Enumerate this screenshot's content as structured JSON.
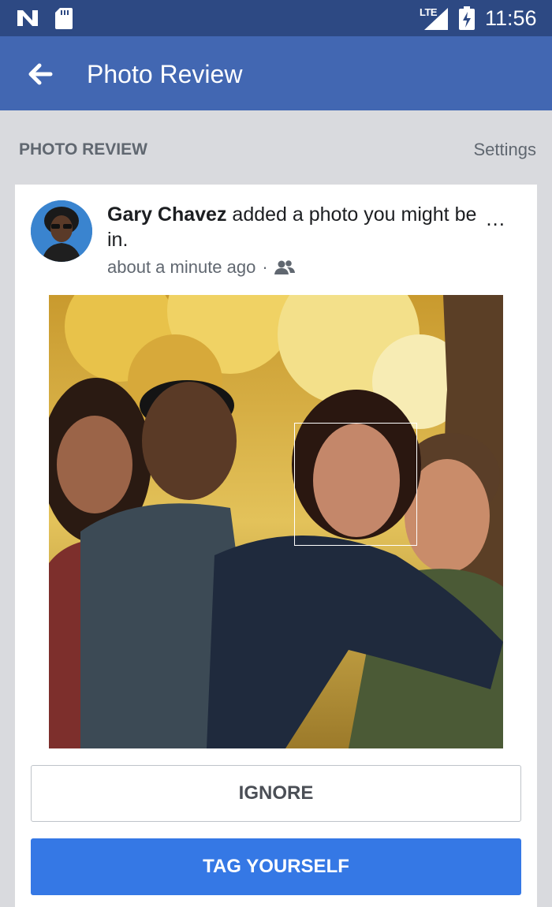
{
  "status_bar": {
    "network": "LTE",
    "time": "11:56",
    "icons": [
      "n-notification-icon",
      "sd-card-icon",
      "signal-icon",
      "battery-charging-icon"
    ]
  },
  "app_bar": {
    "title": "Photo Review",
    "back_icon": "arrow-left-icon",
    "color": "#4267b2"
  },
  "section": {
    "header": "PHOTO REVIEW",
    "settings_label": "Settings"
  },
  "post": {
    "author": "Gary Chavez",
    "action_text": " added a photo you might be in.",
    "more_label": "...",
    "timestamp": "about a minute ago",
    "separator": "·",
    "audience_icon": "friends-icon"
  },
  "actions": {
    "ignore_label": "IGNORE",
    "tag_label": "TAG YOURSELF",
    "tag_color": "#3578e5"
  }
}
